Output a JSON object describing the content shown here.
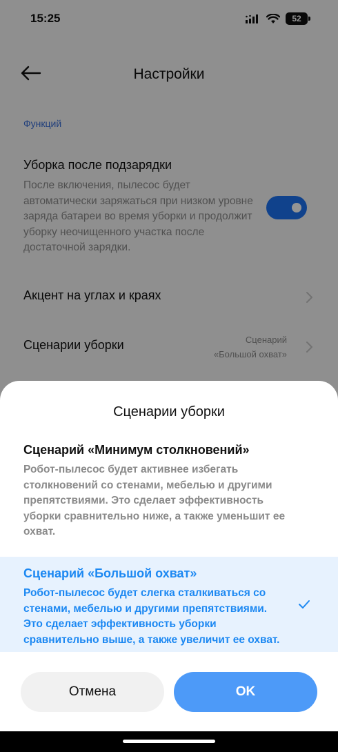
{
  "status_bar": {
    "time": "15:25",
    "battery": "52",
    "icons": [
      "signal-icon",
      "wifi-icon",
      "battery-icon"
    ]
  },
  "header": {
    "title": "Настройки",
    "back_icon": "arrow-left-icon"
  },
  "section": {
    "title": "Функций"
  },
  "settings": {
    "recharge": {
      "title": "Уборка после подзарядки",
      "description": "После включения, пылесос будет автоматически заряжаться при низком уровне заряда батареи во время уборки и продолжит уборку неочищенного участка после достаточной зарядки.",
      "enabled": true
    },
    "corners": {
      "title": "Акцент на углах и краях"
    },
    "scenarios": {
      "title": "Сценарии уборки",
      "value_line1": "Сценарий",
      "value_line2": "«Большой охват»"
    }
  },
  "sheet": {
    "title": "Сценарии уборки",
    "options": [
      {
        "title": "Сценарий «Минимум столкновений»",
        "description": "Робот-пылесос будет активнее избегать столкновений со стенами, мебелью и другими препятствиями. Это сделает эффективность уборки сравнительно ниже, а также уменьшит ее охват.",
        "selected": false
      },
      {
        "title": "Сценарий «Большой охват»",
        "description": "Робот-пылесос будет слегка сталкиваться со стенами, мебелью и другими препятствиями. Это сделает эффективность уборки сравнительно выше, а также увеличит ее охват.",
        "selected": true
      }
    ],
    "cancel_label": "Отмена",
    "ok_label": "OK"
  },
  "colors": {
    "accent": "#1c72f2",
    "selected_text": "#1c88f2",
    "selected_bg": "#e7f2fe",
    "ok_button": "#4d9af8"
  }
}
